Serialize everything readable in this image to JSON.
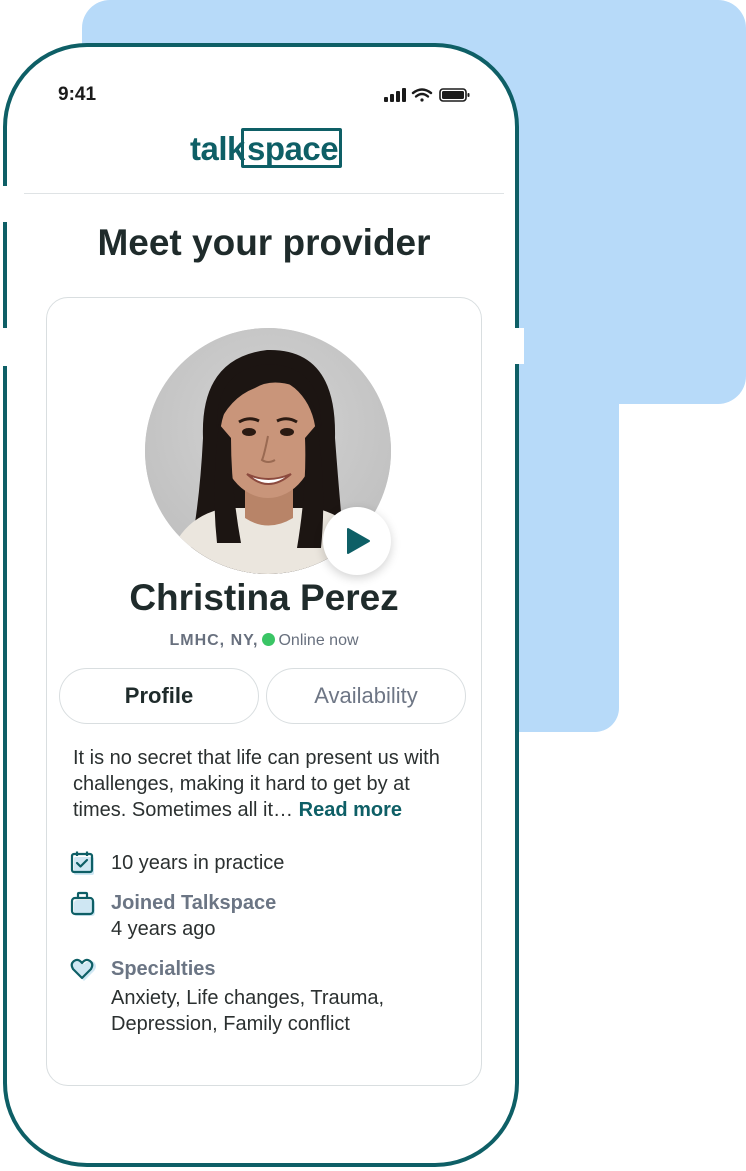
{
  "status_bar": {
    "time": "9:41"
  },
  "brand": {
    "logo_left": "talk",
    "logo_right": "space",
    "color": "#0e5f66"
  },
  "page": {
    "title": "Meet your provider"
  },
  "provider": {
    "name": "Christina Perez",
    "license": "LMHC, NY,",
    "status": "Online now",
    "status_color": "#3ac565"
  },
  "tabs": [
    {
      "label": "Profile",
      "selected": true
    },
    {
      "label": "Availability",
      "selected": false
    }
  ],
  "bio": {
    "text": "It is no secret that life can present us with challenges, making it hard to get by at times. Sometimes all it…",
    "read_more": "Read more"
  },
  "details": {
    "experience": "10 years in practice",
    "joined_label": "Joined Talkspace",
    "joined_value": "4 years ago",
    "specialties_label": "Specialties",
    "specialties_line1": "Anxiety, Life changes, Trauma,",
    "specialties_line2": "Depression, Family conflict"
  },
  "icons": {
    "calendar": "calendar-check-icon",
    "briefcase": "briefcase-icon",
    "heart": "heart-icon",
    "play": "play-icon"
  },
  "colors": {
    "accent_bg": "#b7daf9",
    "frame": "#0e5f66"
  }
}
